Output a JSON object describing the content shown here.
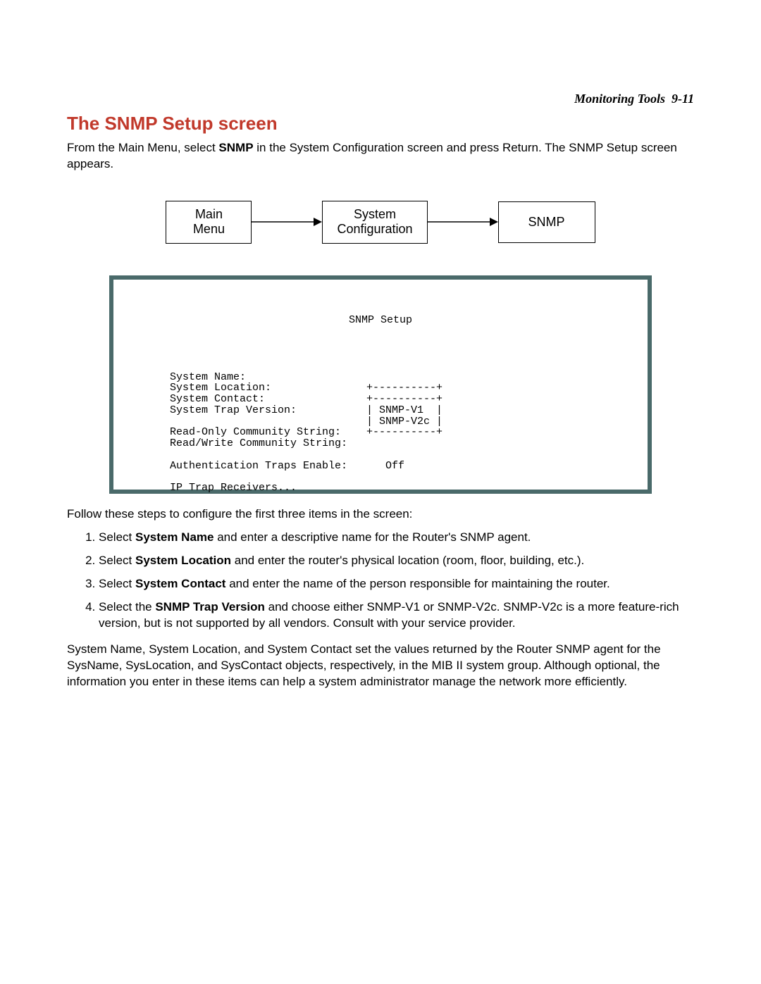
{
  "header": {
    "running_head_label": "Monitoring Tools",
    "running_head_page": "9-11"
  },
  "title": "The SNMP Setup screen",
  "intro": {
    "pre": "From the Main Menu, select ",
    "bold": "SNMP",
    "post": " in the System Configuration screen and press Return. The SNMP Setup screen appears."
  },
  "flow": {
    "box1_line1": "Main",
    "box1_line2": "Menu",
    "box2_line1": "System",
    "box2_line2": "Configuration",
    "box3": "SNMP"
  },
  "terminal": {
    "title": "SNMP Setup",
    "lines": {
      "sys_name": "System Name:",
      "sys_loc": "System Location:               +----------+",
      "sys_contact": "System Contact:                +----------+",
      "sys_trap": "System Trap Version:           | SNMP-V1  |",
      "trap_v2": "                               | SNMP-V2c |",
      "ro_comm": "Read-Only Community String:    +----------+",
      "rw_comm": "Read/Write Community String:",
      "blank1": "",
      "auth_traps": "Authentication Traps Enable:      Off",
      "blank2": "",
      "ip_trap": "IP Trap Receivers..."
    }
  },
  "followup": "Follow these steps to configure the first three items in the screen:",
  "steps": [
    {
      "pre": "Select ",
      "bold": "System Name",
      "post": " and enter a descriptive name for the Router's SNMP agent."
    },
    {
      "pre": "Select ",
      "bold": "System Location",
      "post": " and enter the router's physical location (room, floor, building, etc.)."
    },
    {
      "pre": "Select ",
      "bold": "System Contact",
      "post": " and enter the name of the person responsible for maintaining the router."
    },
    {
      "pre": "Select the ",
      "bold": "SNMP Trap Version",
      "post": " and choose either SNMP-V1 or SNMP-V2c. SNMP-V2c is a more feature-rich version, but is not supported by all vendors. Consult with your service provider."
    }
  ],
  "closing": "System Name, System Location, and System Contact set the values returned by the Router SNMP agent for the SysName, SysLocation, and SysContact objects, respectively, in the MIB II system group. Although optional, the information you enter in these items can help a system administrator manage the network more efficiently."
}
